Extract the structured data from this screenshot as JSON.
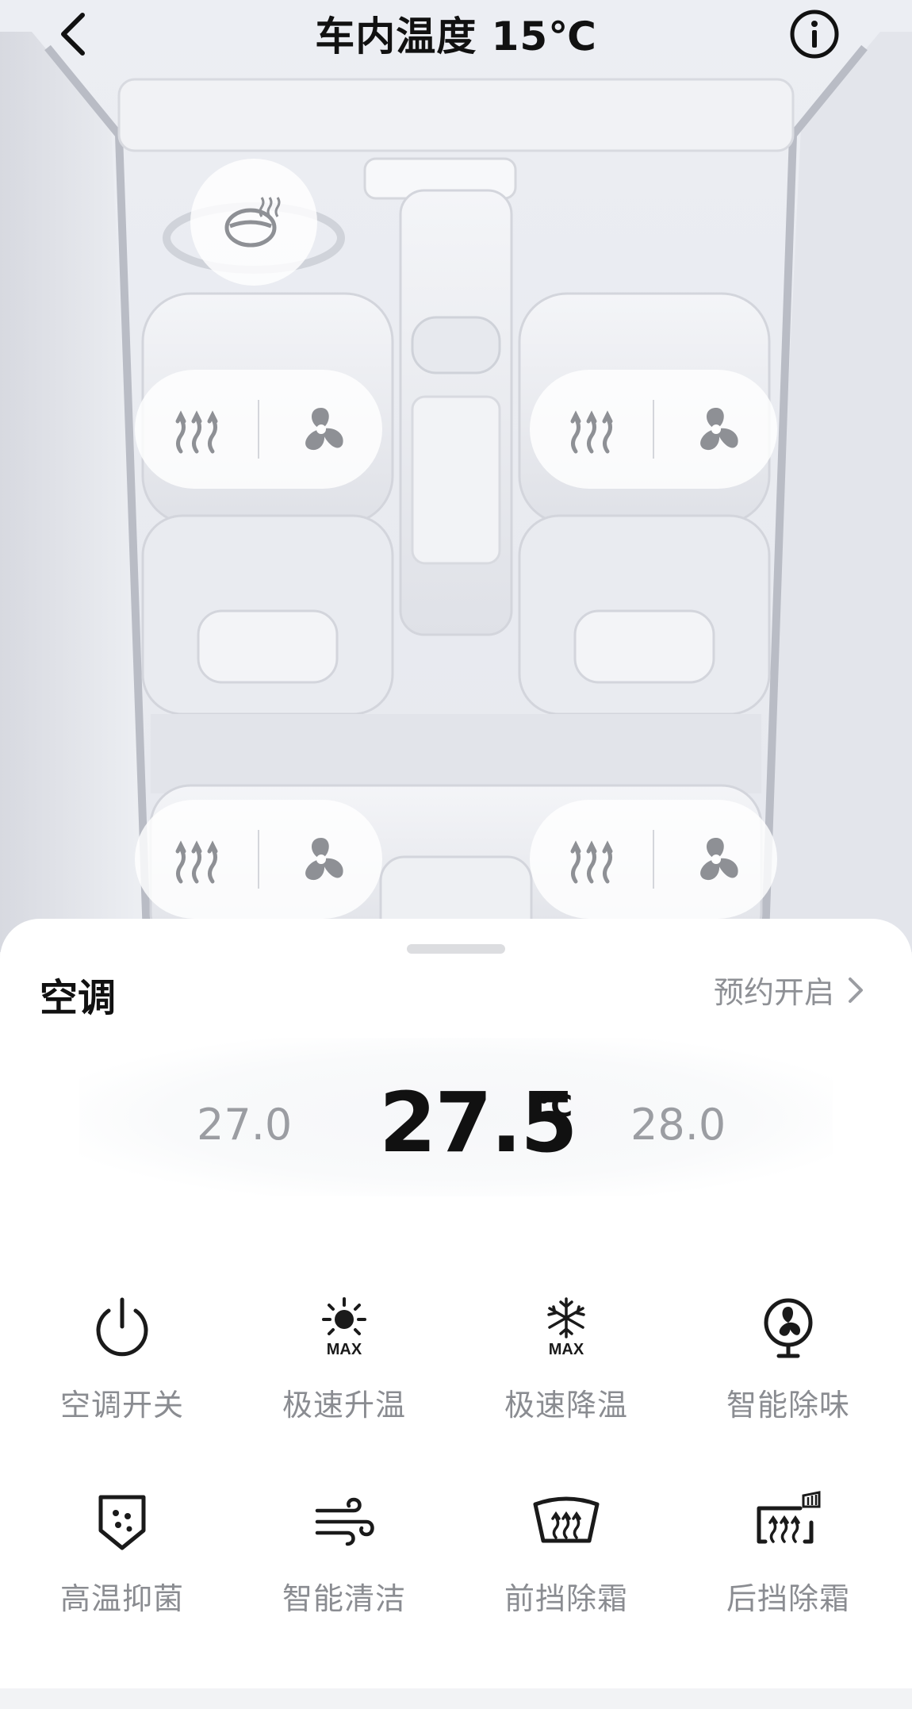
{
  "header": {
    "title": "车内温度 15℃",
    "back_icon": "chevron-left-icon",
    "info_icon": "info-circle-icon"
  },
  "car": {
    "steering_heat_icon": "steering-wheel-heat-icon",
    "seats": [
      {
        "position": "front-left",
        "heat_icon": "seat-heat-icon",
        "vent_icon": "seat-ventilation-icon"
      },
      {
        "position": "front-right",
        "heat_icon": "seat-heat-icon",
        "vent_icon": "seat-ventilation-icon"
      },
      {
        "position": "rear-left",
        "heat_icon": "seat-heat-icon",
        "vent_icon": "seat-ventilation-icon"
      },
      {
        "position": "rear-right",
        "heat_icon": "seat-heat-icon",
        "vent_icon": "seat-ventilation-icon"
      }
    ]
  },
  "panel": {
    "title": "空调",
    "schedule_label": "预约开启",
    "temperature": {
      "prev": "27.0",
      "current": "27.5",
      "unit": "℃",
      "next": "28.0"
    },
    "controls": [
      {
        "label": "空调开关",
        "icon": "power-icon"
      },
      {
        "label": "极速升温",
        "icon": "sun-max-icon"
      },
      {
        "label": "极速降温",
        "icon": "snowflake-max-icon"
      },
      {
        "label": "智能除味",
        "icon": "fan-icon"
      },
      {
        "label": "高温抑菌",
        "icon": "shield-sterilize-icon"
      },
      {
        "label": "智能清洁",
        "icon": "wind-icon"
      },
      {
        "label": "前挡除霜",
        "icon": "front-defrost-icon"
      },
      {
        "label": "后挡除霜",
        "icon": "rear-defrost-icon"
      }
    ]
  },
  "colors": {
    "text_primary": "#111111",
    "text_secondary": "#8a8c91",
    "panel_bg": "#ffffff",
    "car_bg": "#e6e8ee"
  }
}
